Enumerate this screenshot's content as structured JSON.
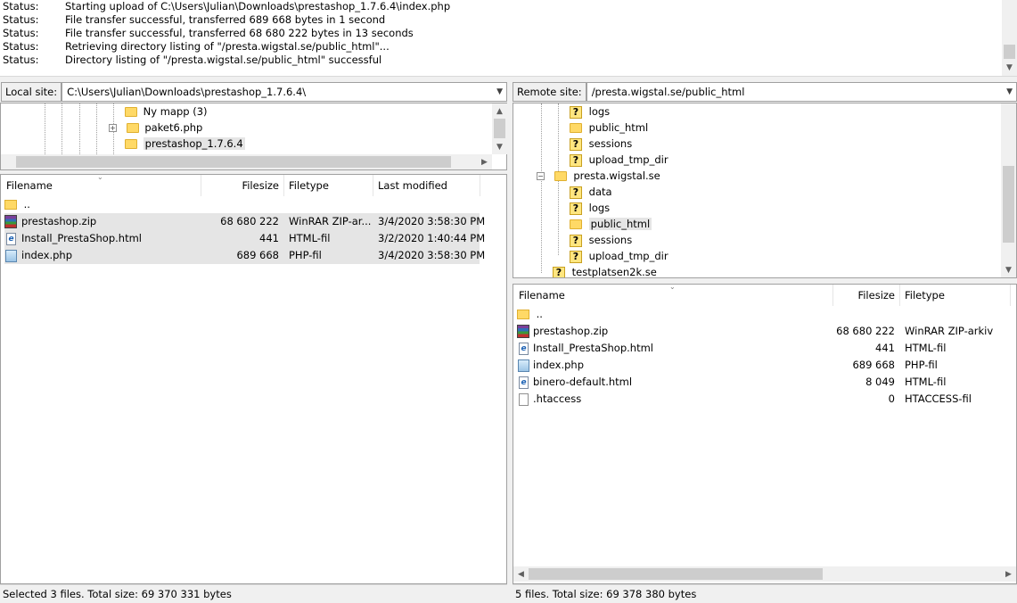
{
  "log": [
    {
      "label": "Status:",
      "msg": "Starting upload of C:\\Users\\Julian\\Downloads\\prestashop_1.7.6.4\\index.php"
    },
    {
      "label": "Status:",
      "msg": "File transfer successful, transferred 689 668 bytes in 1 second"
    },
    {
      "label": "Status:",
      "msg": "File transfer successful, transferred 68 680 222 bytes in 13 seconds"
    },
    {
      "label": "Status:",
      "msg": "Retrieving directory listing of \"/presta.wigstal.se/public_html\"..."
    },
    {
      "label": "Status:",
      "msg": "Directory listing of \"/presta.wigstal.se/public_html\" successful"
    }
  ],
  "local": {
    "site_label": "Local site:",
    "path": "C:\\Users\\Julian\\Downloads\\prestashop_1.7.6.4\\",
    "tree": [
      {
        "name": "Ny mapp (3)"
      },
      {
        "name": "paket6.php",
        "expander": "+"
      },
      {
        "name": "prestashop_1.7.6.4"
      }
    ],
    "columns": {
      "filename": "Filename",
      "filesize": "Filesize",
      "filetype": "Filetype",
      "modified": "Last modified"
    },
    "parent": "..",
    "files": [
      {
        "name": "prestashop.zip",
        "size": "68 680 222",
        "type": "WinRAR ZIP-ar...",
        "modified": "3/4/2020 3:58:30 PM",
        "icon": "zip-icon"
      },
      {
        "name": "Install_PrestaShop.html",
        "size": "441",
        "type": "HTML-fil",
        "modified": "3/2/2020 1:40:44 PM",
        "icon": "html-icon"
      },
      {
        "name": "index.php",
        "size": "689 668",
        "type": "PHP-fil",
        "modified": "3/4/2020 3:58:30 PM",
        "icon": "php-icon"
      }
    ],
    "status": "Selected 3 files. Total size: 69 370 331 bytes"
  },
  "remote": {
    "site_label": "Remote site:",
    "path": "/presta.wigstal.se/public_html",
    "tree": [
      {
        "name": "logs",
        "q": true
      },
      {
        "name": "public_html",
        "q": false
      },
      {
        "name": "sessions",
        "q": true
      },
      {
        "name": "upload_tmp_dir",
        "q": true
      },
      {
        "name": "presta.wigstal.se",
        "q": false,
        "expander": "−"
      },
      {
        "name": "data",
        "q": true
      },
      {
        "name": "logs",
        "q": true
      },
      {
        "name": "public_html",
        "q": false
      },
      {
        "name": "sessions",
        "q": true
      },
      {
        "name": "upload_tmp_dir",
        "q": true
      },
      {
        "name": "testplatsen2k.se",
        "q": true
      }
    ],
    "columns": {
      "filename": "Filename",
      "filesize": "Filesize",
      "filetype": "Filetype"
    },
    "parent": "..",
    "files": [
      {
        "name": "prestashop.zip",
        "size": "68 680 222",
        "type": "WinRAR ZIP-arkiv",
        "icon": "zip-icon"
      },
      {
        "name": "Install_PrestaShop.html",
        "size": "441",
        "type": "HTML-fil",
        "icon": "html-icon"
      },
      {
        "name": "index.php",
        "size": "689 668",
        "type": "PHP-fil",
        "icon": "php-icon"
      },
      {
        "name": "binero-default.html",
        "size": "8 049",
        "type": "HTML-fil",
        "icon": "html-icon"
      },
      {
        "name": ".htaccess",
        "size": "0",
        "type": "HTACCESS-fil",
        "icon": "file-icon"
      }
    ],
    "status": "5 files. Total size: 69 378 380 bytes"
  }
}
